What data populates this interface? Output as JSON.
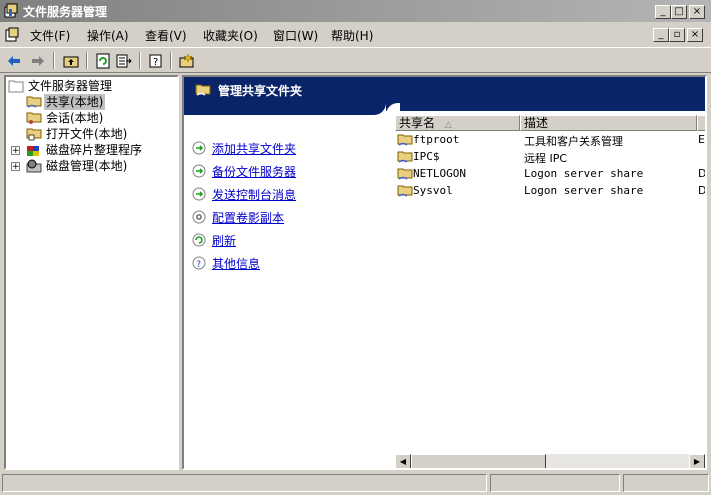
{
  "window": {
    "title": "文件服务器管理"
  },
  "menu": {
    "items": [
      {
        "label": "文件(F)"
      },
      {
        "label": "操作(A)"
      },
      {
        "label": "查看(V)"
      },
      {
        "label": "收藏夹(O)"
      },
      {
        "label": "窗口(W)"
      },
      {
        "label": "帮助(H)"
      }
    ]
  },
  "tree": {
    "root": "文件服务器管理",
    "items": [
      {
        "label": "共享(本地)",
        "selected": true
      },
      {
        "label": "会话(本地)"
      },
      {
        "label": "打开文件(本地)"
      },
      {
        "label": "磁盘碎片整理程序"
      },
      {
        "label": "磁盘管理(本地)"
      }
    ]
  },
  "panel": {
    "title": "管理共享文件夹",
    "tasks": [
      {
        "label": "添加共享文件夹",
        "icon": "arrow-right-green-icon"
      },
      {
        "label": "备份文件服务器",
        "icon": "arrow-right-green-icon"
      },
      {
        "label": "发送控制台消息",
        "icon": "arrow-right-green-icon"
      },
      {
        "label": "配置卷影副本",
        "icon": "gear-icon"
      },
      {
        "label": "刷新",
        "icon": "refresh-icon"
      },
      {
        "label": "其他信息",
        "icon": "help-icon"
      }
    ]
  },
  "list": {
    "columns": [
      "共享名",
      "描述",
      ""
    ],
    "rows": [
      {
        "name": "ftproot",
        "desc": "工具和客户关系管理",
        "extra": "E"
      },
      {
        "name": "IPC$",
        "desc": "远程 IPC",
        "extra": ""
      },
      {
        "name": "NETLOGON",
        "desc": "Logon server share",
        "extra": "D"
      },
      {
        "name": "Sysvol",
        "desc": "Logon server share",
        "extra": "D"
      }
    ]
  },
  "colors": {
    "banner": "#0a246a",
    "link": "#0000cc",
    "chrome": "#d4d0c8"
  }
}
